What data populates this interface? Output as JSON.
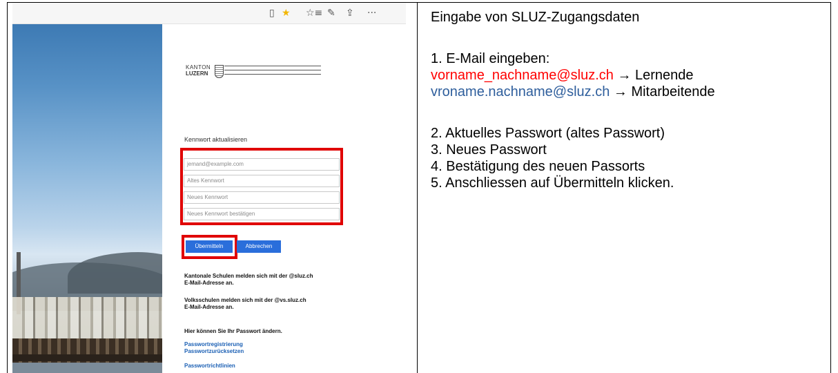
{
  "browser_toolbar": {
    "icons": [
      "reading-view-icon",
      "favorite-star-icon",
      "favorites-list-icon",
      "pen-icon",
      "share-icon",
      "more-icon"
    ],
    "glyphs": {
      "reading": "▯",
      "star": "★",
      "favorites": "☆≡",
      "pen": "✎",
      "share": "⇪",
      "more": "···"
    },
    "star_color": "#f2b600"
  },
  "login": {
    "logo_line1": "KANTON",
    "logo_line2": "LUZERN",
    "form_title": "Kennwort aktualisieren",
    "email_placeholder": "jemand@example.com",
    "old_password_placeholder": "Altes Kennwort",
    "new_password_placeholder": "Neues Kennwort",
    "confirm_password_placeholder": "Neues Kennwort bestätigen",
    "submit_label": "Übermitteln",
    "cancel_label": "Abbrechen",
    "info1_line1": "Kantonale Schulen melden sich mit der @sluz.ch",
    "info1_line2": "E-Mail-Adresse an.",
    "info2_line1": "Volksschulen melden sich mit der @vs.sluz.ch",
    "info2_line2": "E-Mail-Adresse an.",
    "info3": "Hier können Sie Ihr Passwort ändern.",
    "link_registration": "Passwortregistrierung",
    "link_reset": "Passwortzurücksetzen",
    "link_policy": "Passwortrichtlinien",
    "button_color": "#2a6edb",
    "highlight_color": "#e00000"
  },
  "instructions": {
    "title": "Eingabe von SLUZ-Zugangsdaten",
    "step1": "1. E-Mail eingeben:",
    "student_email": "vorname_nachname@sluz.ch",
    "student_arrow": "→",
    "student_role": "Lernende",
    "staff_email": "vroname.nachname@sluz.ch",
    "staff_arrow": "→",
    "staff_role": "Mitarbeitende",
    "step2": "2. Aktuelles Passwort (altes Passwort)",
    "step3": "3. Neues Passwort",
    "step4": "4. Bestätigung des neuen Passorts",
    "step5": "5. Anschliessen auf Übermitteln klicken.",
    "student_color": "#ff0000",
    "staff_color": "#2e5e9c"
  }
}
